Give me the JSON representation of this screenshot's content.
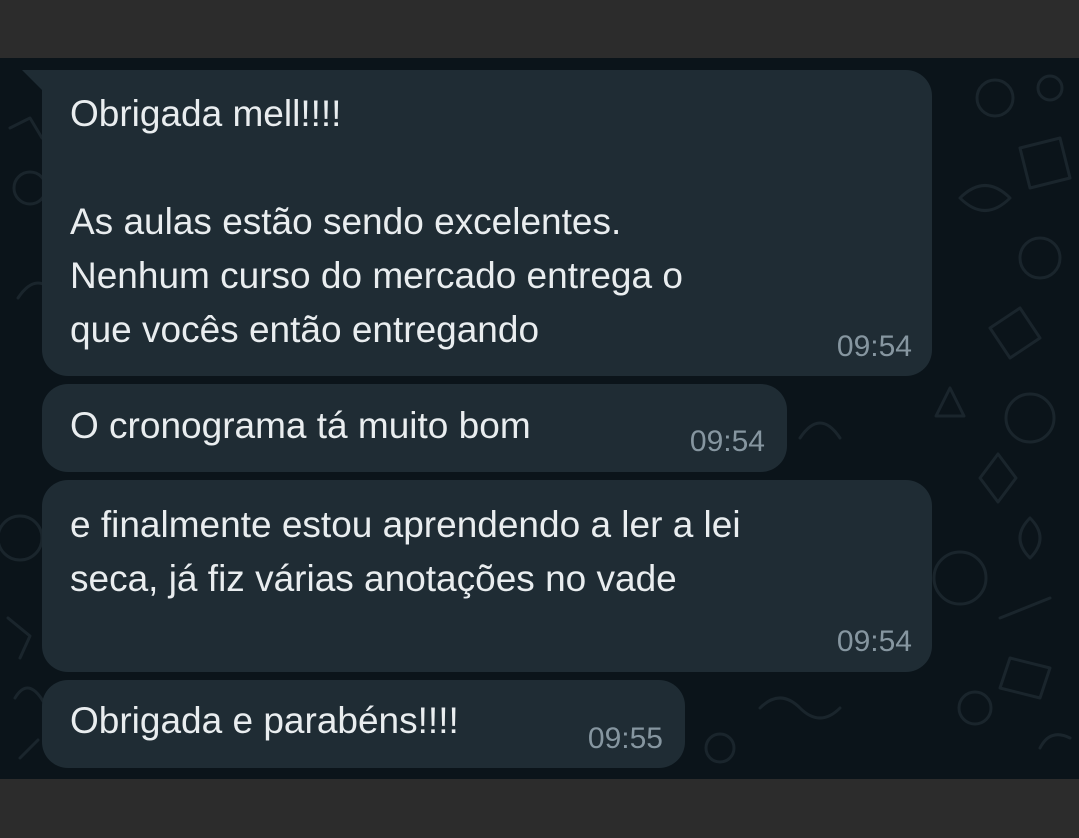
{
  "messages": [
    {
      "text": "Obrigada mell!!!!\n\nAs aulas estão sendo excelentes.\nNenhum curso do mercado entrega o\nque vocês então entregando",
      "time": "09:54"
    },
    {
      "text": "O cronograma tá muito bom",
      "time": "09:54"
    },
    {
      "text": "e finalmente estou aprendendo a ler a lei\nseca, já fiz várias anotações no vade",
      "time": "09:54"
    },
    {
      "text": "Obrigada e parabéns!!!!",
      "time": "09:55"
    }
  ],
  "colors": {
    "chat_background": "#0b141a",
    "bubble_background": "#1f2c34",
    "message_text": "#e9edef",
    "timestamp_text": "#8696a0",
    "frame": "#2c2c2c"
  }
}
